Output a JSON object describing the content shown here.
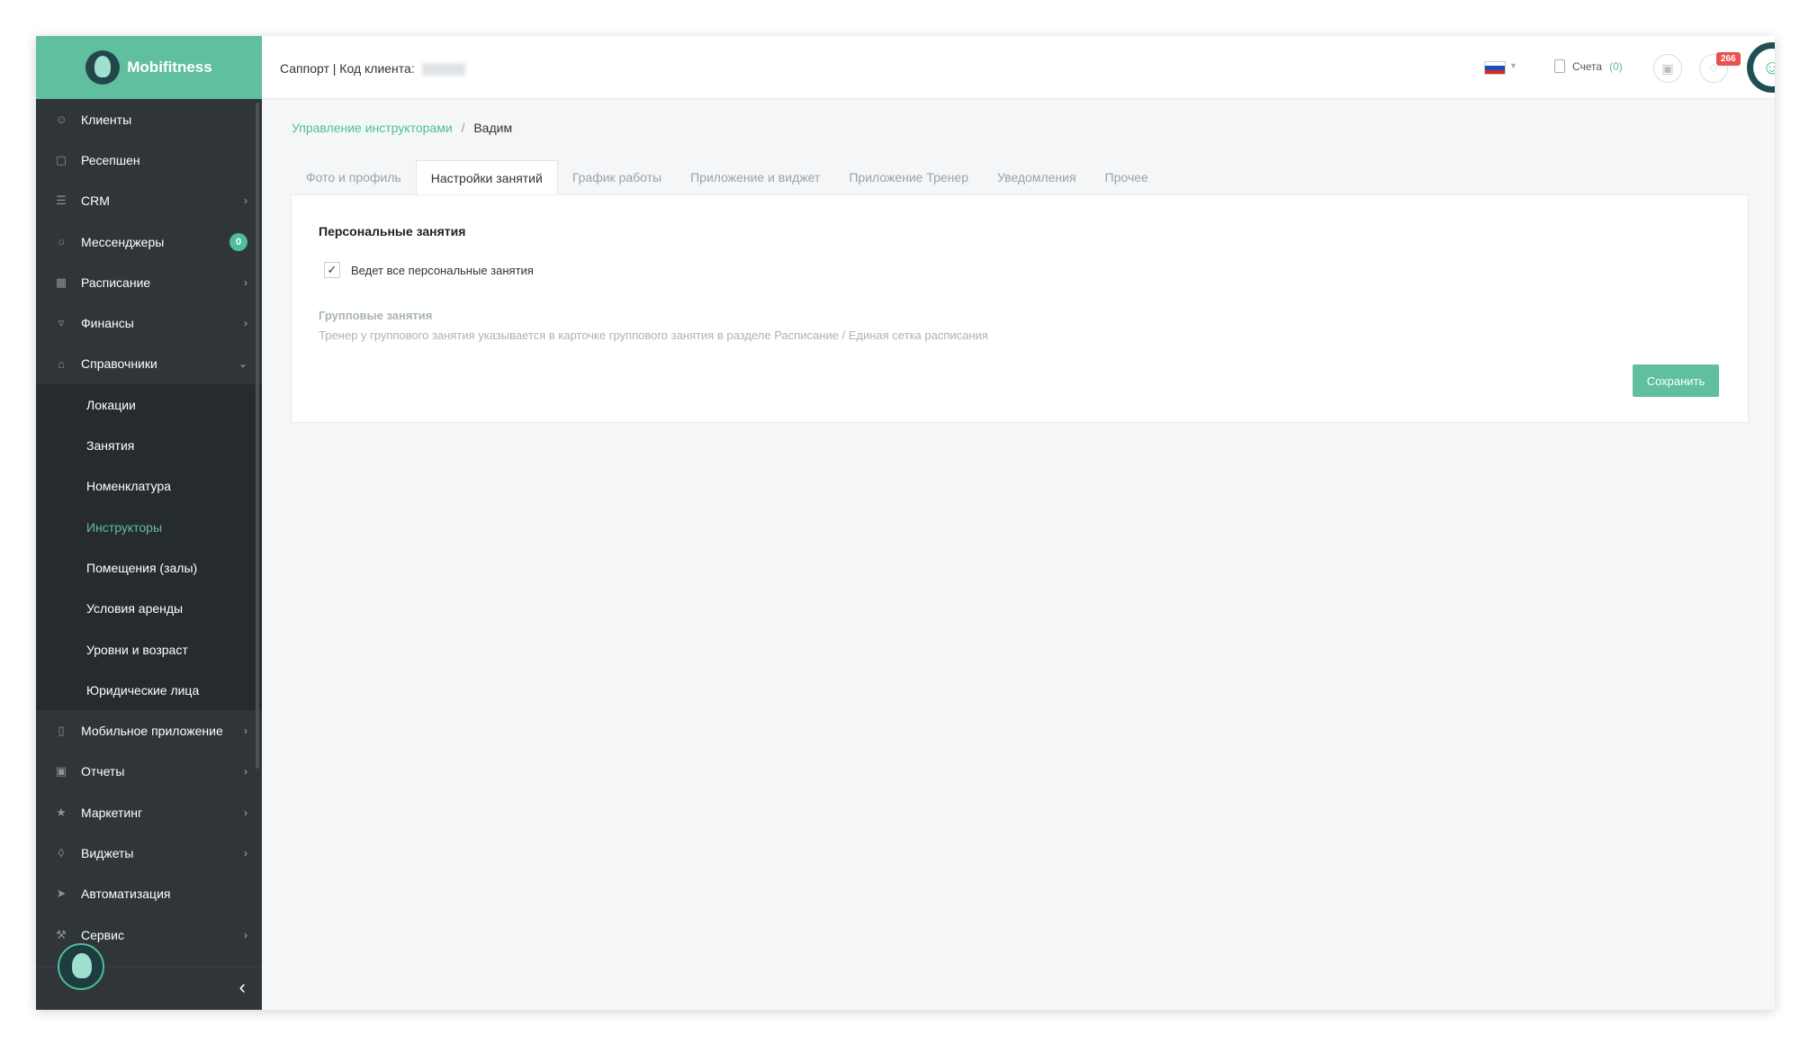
{
  "brand": {
    "name": "Mobifitness"
  },
  "header": {
    "support_text": "Саппорт | Код клиента:",
    "invoices_label": "Счета",
    "invoices_count": "(0)",
    "notifications_count": "266"
  },
  "sidebar": {
    "items": [
      {
        "label": "Клиенты",
        "icon": "user-icon"
      },
      {
        "label": "Ресепшен",
        "icon": "clipboard-icon"
      },
      {
        "label": "CRM",
        "icon": "list-icon"
      },
      {
        "label": "Мессенджеры",
        "icon": "chat-icon",
        "badge": "0"
      },
      {
        "label": "Расписание",
        "icon": "calendar-icon"
      },
      {
        "label": "Финансы",
        "icon": "cart-icon"
      },
      {
        "label": "Справочники",
        "icon": "home-icon"
      }
    ],
    "sub_items": [
      {
        "label": "Локации"
      },
      {
        "label": "Занятия"
      },
      {
        "label": "Номенклатура"
      },
      {
        "label": "Инструкторы"
      },
      {
        "label": "Помещения (залы)"
      },
      {
        "label": "Условия аренды"
      },
      {
        "label": "Уровни и возраст"
      },
      {
        "label": "Юридические лица"
      }
    ],
    "items_after": [
      {
        "label": "Мобильное приложение",
        "icon": "mobile-icon"
      },
      {
        "label": "Отчеты",
        "icon": "report-icon"
      },
      {
        "label": "Маркетинг",
        "icon": "megaphone-icon"
      },
      {
        "label": "Виджеты",
        "icon": "tag-icon"
      },
      {
        "label": "Автоматизация",
        "icon": "rocket-icon"
      },
      {
        "label": "Сервис",
        "icon": "wrench-icon"
      }
    ]
  },
  "breadcrumb": {
    "parent": "Управление инструкторами",
    "separator": "/",
    "current": "Вадим"
  },
  "tabs": [
    "Фото и профиль",
    "Настройки занятий",
    "График работы",
    "Приложение и виджет",
    "Приложение Тренер",
    "Уведомления",
    "Прочее"
  ],
  "panel": {
    "personal_title": "Персональные занятия",
    "checkbox_label": "Ведет все персональные занятия",
    "checkbox_checked": true,
    "group_title": "Групповые занятия",
    "group_desc": "Тренер у группового занятия указывается в карточке группового занятия в разделе Расписание / Единая сетка расписания",
    "save_label": "Сохранить"
  },
  "colors": {
    "accent": "#5fbf9f",
    "sidebar_bg": "#2f3538",
    "badge_red": "#e8524f"
  }
}
